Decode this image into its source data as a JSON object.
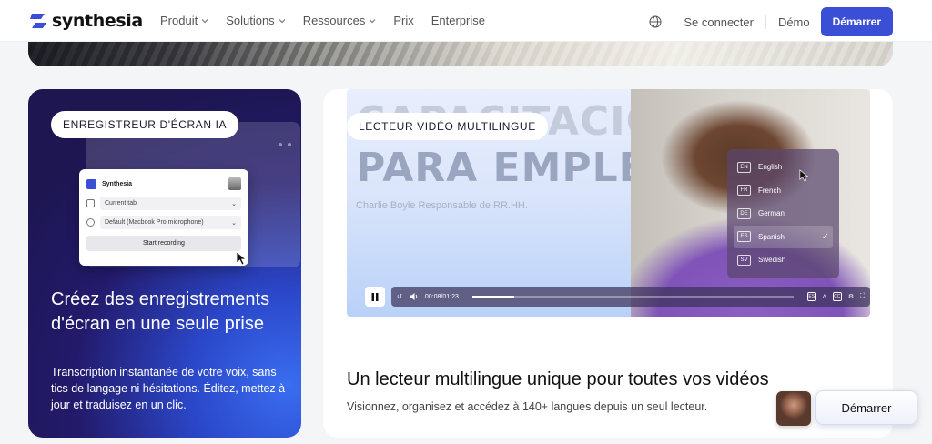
{
  "nav": {
    "brand": "synthesia",
    "links": [
      {
        "label": "Produit",
        "dropdown": true
      },
      {
        "label": "Solutions",
        "dropdown": true
      },
      {
        "label": "Ressources",
        "dropdown": true
      },
      {
        "label": "Prix",
        "dropdown": false
      },
      {
        "label": "Enterprise",
        "dropdown": false
      }
    ],
    "login": "Se connecter",
    "demo": "Démo",
    "cta": "Démarrer"
  },
  "left_card": {
    "badge": "ENREGISTREUR D'ÉCRAN IA",
    "panel": {
      "app_name": "Synthesia",
      "source": "Current tab",
      "mic": "Default (Macbook Pro microphone)",
      "start": "Start recording"
    },
    "title": "Créez des enregistrements d'écran en une seule prise",
    "description": "Transcription instantanée de votre voix, sans tics de langage ni hésitations. Éditez, mettez à jour et traduisez en un clic."
  },
  "right_card": {
    "badge": "LECTEUR VIDÉO MULTILINGUE",
    "video": {
      "title_line1": "CAPACITACIÓN",
      "title_line2": "PARA EMPLEADOS",
      "subtitle": "Charlie Boyle Responsable de RR.HH.",
      "languages": [
        {
          "code": "EN",
          "name": "English",
          "selected": false
        },
        {
          "code": "FR",
          "name": "French",
          "selected": false
        },
        {
          "code": "DE",
          "name": "German",
          "selected": false
        },
        {
          "code": "ES",
          "name": "Spanish",
          "selected": true
        },
        {
          "code": "SV",
          "name": "Swedish",
          "selected": false
        }
      ],
      "check": "✓",
      "time": "00:08/01:23",
      "progress": 0.13,
      "current_lang": "ES",
      "cc": "CC"
    },
    "title": "Un lecteur multilingue unique pour toutes vos vidéos",
    "description": "Visionnez, organisez et accédez à 140+ langues depuis un seul lecteur."
  },
  "floating_cta": "Démarrer",
  "colors": {
    "accent": "#3a4fd6",
    "left_card_dark": "#1d1650",
    "left_card_light": "#3a6df0"
  }
}
